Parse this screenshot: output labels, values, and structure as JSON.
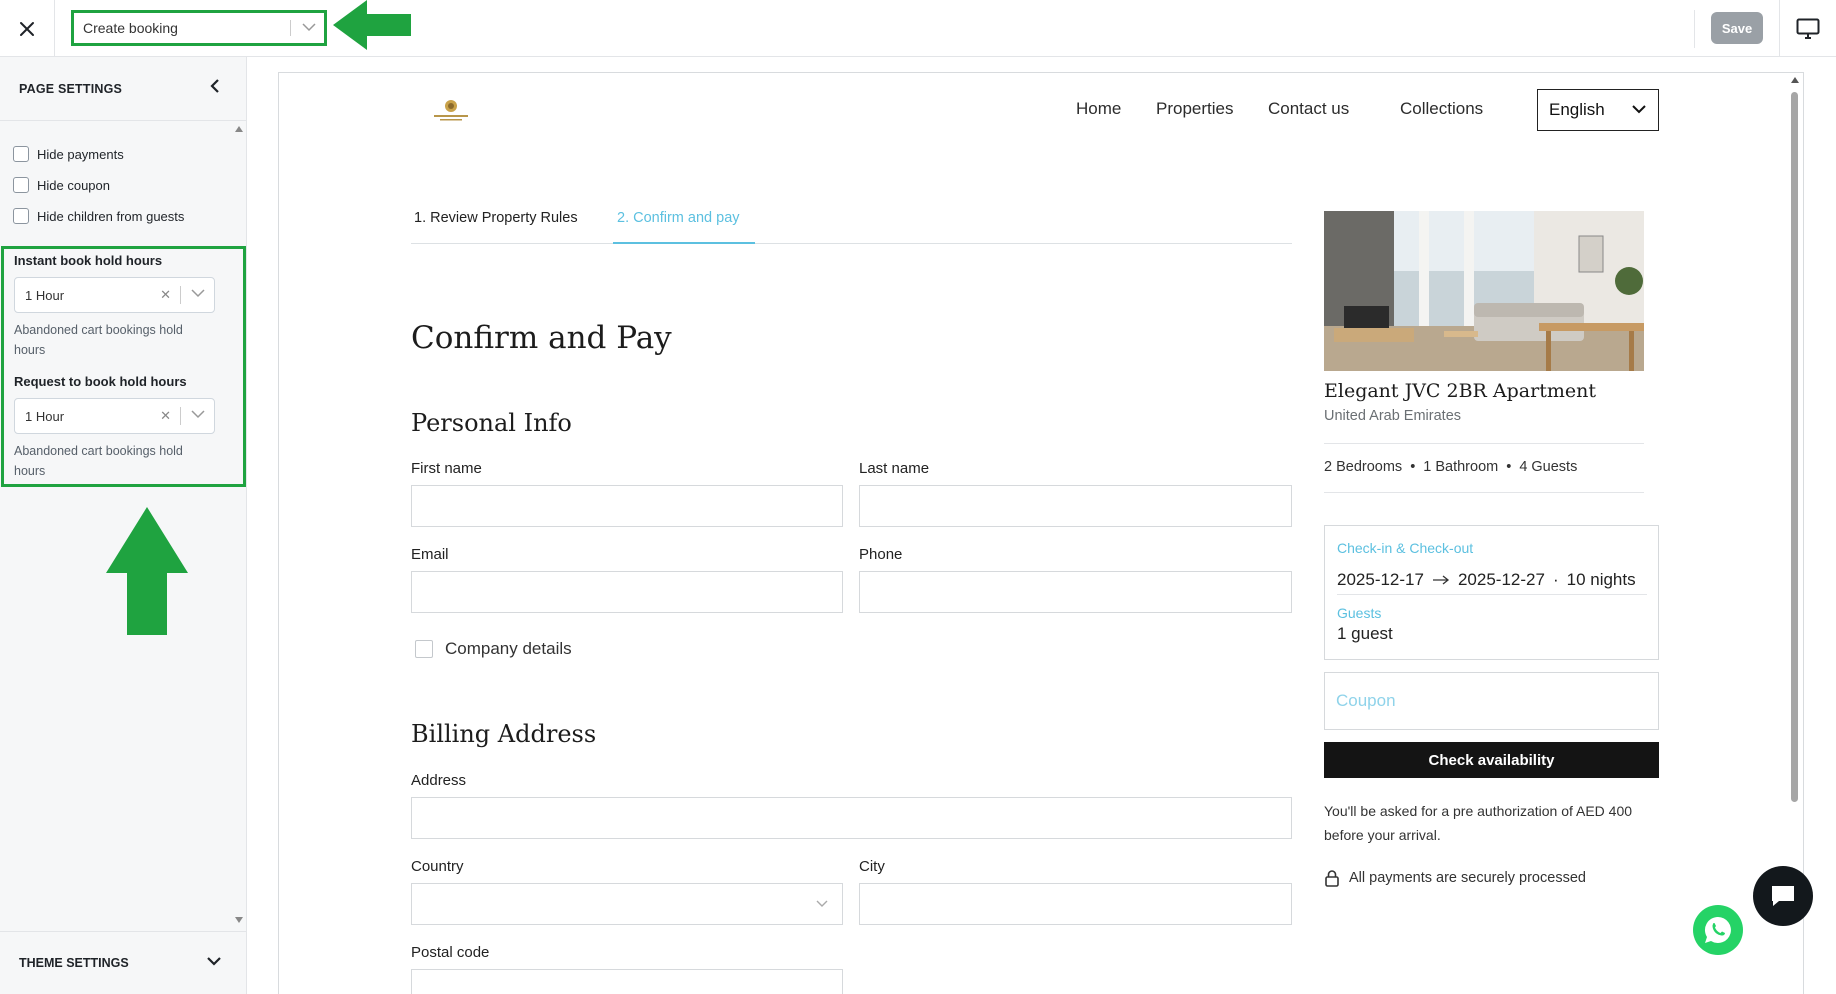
{
  "topbar": {
    "page_select_value": "Create booking",
    "save_label": "Save"
  },
  "sidebar": {
    "header": "PAGE SETTINGS",
    "checkboxes": [
      {
        "label": "Hide payments",
        "checked": false
      },
      {
        "label": "Hide coupon",
        "checked": false
      },
      {
        "label": "Hide children from guests",
        "checked": false
      }
    ],
    "instant_label": "Instant book hold hours",
    "instant_value": "1 Hour",
    "instant_help": "Abandoned cart bookings hold hours",
    "request_label": "Request to book hold hours",
    "request_value": "1 Hour",
    "request_help": "Abandoned cart bookings hold hours",
    "footer": "THEME SETTINGS",
    "highlight_color": "#1fa340"
  },
  "site": {
    "nav": [
      "Home",
      "Properties",
      "Contact us",
      "Collections"
    ],
    "language": "English",
    "steps": [
      "1. Review Property Rules",
      "2. Confirm and pay"
    ],
    "accent_color": "#5cc0e0"
  },
  "form": {
    "title": "Confirm and Pay",
    "personal_heading": "Personal Info",
    "first_name": "First name",
    "last_name": "Last name",
    "email": "Email",
    "phone": "Phone",
    "company": "Company details",
    "billing_heading": "Billing Address",
    "address": "Address",
    "country": "Country",
    "city": "City",
    "postal": "Postal code"
  },
  "summary": {
    "property_title": "Elegant JVC 2BR Apartment",
    "country": "United Arab Emirates",
    "specs": [
      "2 Bedrooms",
      "1 Bathroom",
      "4 Guests"
    ],
    "spec_sep": "•",
    "dates_label": "Check-in & Check-out",
    "checkin": "2025-12-17",
    "checkout": "2025-12-27",
    "nights": "10 nights",
    "dot": "·",
    "guests_label": "Guests",
    "guests_value": "1 guest",
    "coupon_placeholder": "Coupon",
    "check_label": "Check availability",
    "preauth": "You'll be asked for a pre authorization of AED 400 before your arrival.",
    "secure": "All payments are securely processed"
  }
}
